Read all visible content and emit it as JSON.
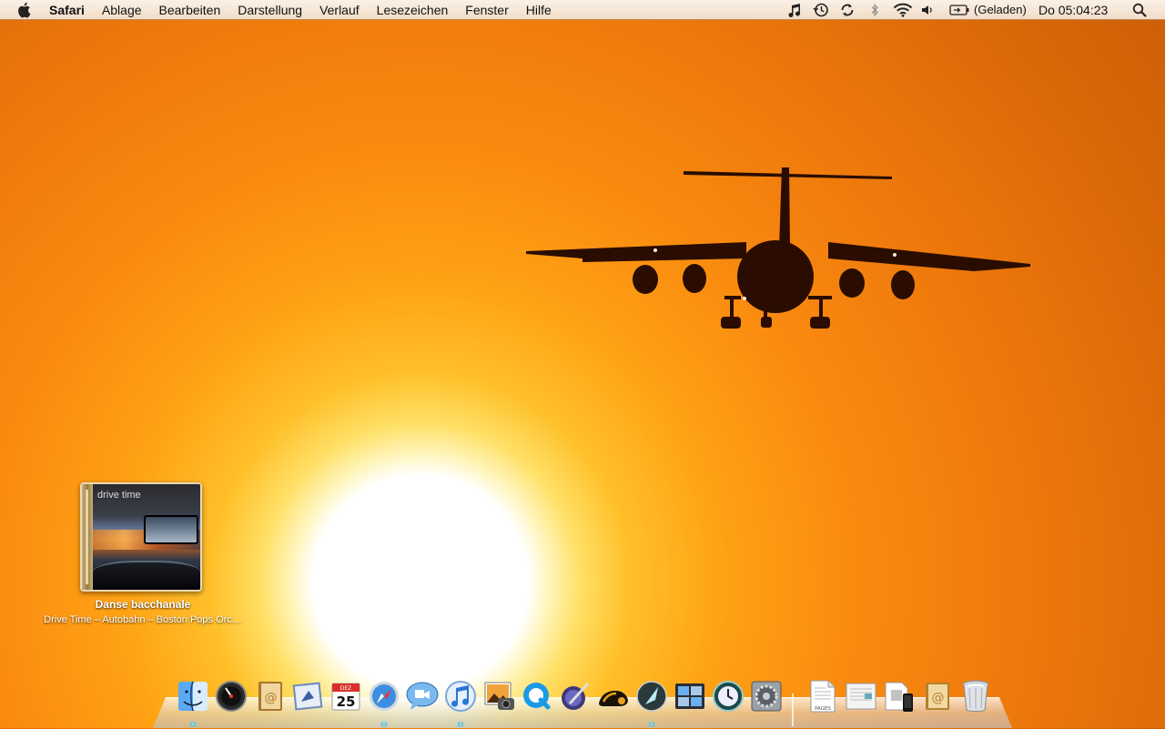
{
  "menubar": {
    "app_name": "Safari",
    "menus": [
      "Ablage",
      "Bearbeiten",
      "Darstellung",
      "Verlauf",
      "Lesezeichen",
      "Fenster",
      "Hilfe"
    ],
    "status_icons": [
      "itunes-note-icon",
      "time-machine-icon",
      "sync-icon",
      "bluetooth-icon",
      "wifi-icon",
      "volume-icon",
      "battery-icon",
      "spotlight-icon"
    ],
    "battery_status": "(Geladen)",
    "clock": "Do 05:04:23"
  },
  "itunes_widget": {
    "album_art_title": "drive time",
    "track_name": "Danse bacchanale",
    "track_details": "Drive Time – Autobahn – Boston Pops Orc…"
  },
  "dock": {
    "apps": [
      {
        "name": "finder-icon"
      },
      {
        "name": "dashboard-icon"
      },
      {
        "name": "address-book-icon"
      },
      {
        "name": "mail-icon"
      },
      {
        "name": "ical-icon",
        "label": "25",
        "month": "DEZ"
      },
      {
        "name": "safari-icon"
      },
      {
        "name": "ichat-icon"
      },
      {
        "name": "itunes-icon"
      },
      {
        "name": "iphoto-icon"
      },
      {
        "name": "quicktime-icon"
      },
      {
        "name": "iweb-icon"
      },
      {
        "name": "front-row-icon"
      },
      {
        "name": "skype-icon"
      },
      {
        "name": "spaces-icon"
      },
      {
        "name": "time-machine-icon"
      },
      {
        "name": "system-preferences-icon"
      }
    ],
    "stack_items": [
      {
        "name": "pages-document-icon",
        "label": "PAGES"
      },
      {
        "name": "document-icon"
      },
      {
        "name": "iphone-stack-icon"
      },
      {
        "name": "address-card-icon"
      },
      {
        "name": "trash-icon"
      }
    ]
  }
}
